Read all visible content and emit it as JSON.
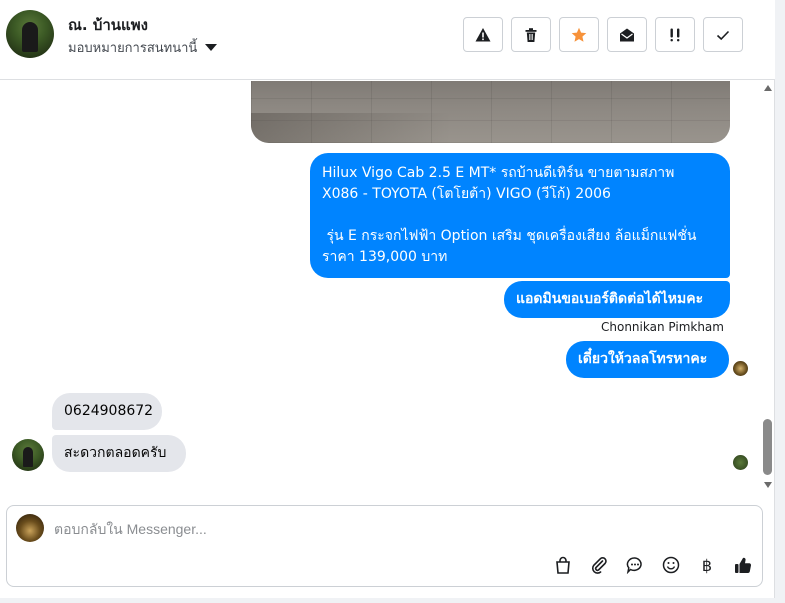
{
  "header": {
    "contact_name": "ณ. บ้านแพง",
    "assign_label": "มอบหมายการสนทนานี้",
    "toolbar_icons": [
      "warning-icon",
      "trash-icon",
      "star-icon",
      "envelope-open-icon",
      "priority-icon",
      "check-icon"
    ],
    "star_color": "#f7923a"
  },
  "messages": {
    "outgoing_listing": "Hilux Vigo Cab 2.5 E MT* รถบ้านดีเทิร์น ขายตามสภาพ\nX086 - TOYOTA (โตโยต้า) VIGO (วีโก้) 2006\n\n รุ่น E กระจกไฟฟ้า Option เสริม ชุดเครื่องเสียง ล้อแม็กแฟชั่น\nราคา 139,000 บาท",
    "outgoing_admin": "แอดมินขอเบอร์ติดต่อได้ไหมคะ",
    "sender_name": "Chonnikan Pimkham",
    "outgoing_wait": "เดี๋ยวให้วลลโทรหาคะ",
    "incoming_phone": "0624908672",
    "incoming_convenient": "สะดวกตลอดครับ",
    "bubble_out_color": "#0084ff",
    "bubble_in_color": "#e4e6eb"
  },
  "composer": {
    "placeholder": "ตอบกลับใน Messenger...",
    "icons": [
      "shopping-bag-icon",
      "paperclip-icon",
      "saved-reply-icon",
      "emoji-icon",
      "baht-icon",
      "thumbs-up-icon"
    ],
    "baht_symbol": "฿"
  }
}
